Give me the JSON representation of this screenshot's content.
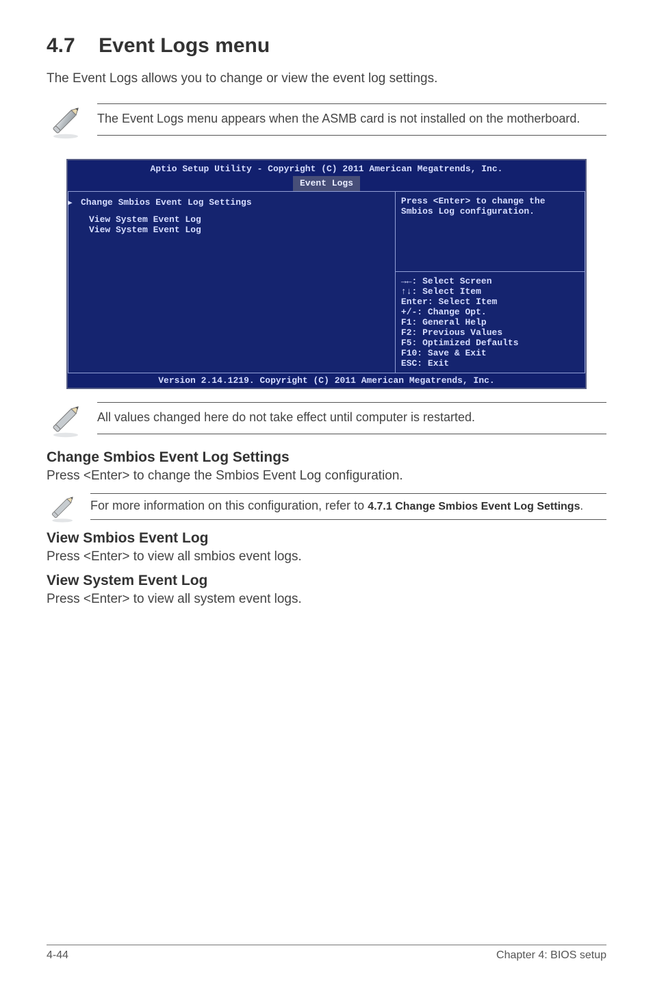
{
  "heading": {
    "number": "4.7",
    "title": "Event Logs menu"
  },
  "intro": "The Event Logs allows you to change or view the event log settings.",
  "notes": {
    "top": "The Event Logs menu appears when the ASMB card is not installed on the motherboard.",
    "after_bios": "All values changed here do not take effect until computer is restarted.",
    "config_ref_pre": "For more information on this configuration, refer to ",
    "config_ref_bold": "4.7.1 Change Smbios Event Log Settings",
    "config_ref_post": "."
  },
  "bios": {
    "title": "Aptio Setup Utility - Copyright (C) 2011 American Megatrends, Inc.",
    "tab": "Event Logs",
    "menu_items": [
      "Change Smbios Event Log Settings",
      "View System Event Log",
      "View System Event Log"
    ],
    "help": "Press <Enter> to change the Smbios Log configuration.",
    "keys": [
      "→←: Select Screen",
      "↑↓:  Select Item",
      "Enter: Select Item",
      "+/-: Change Opt.",
      "F1: General Help",
      "F2: Previous Values",
      "F5: Optimized Defaults",
      "F10: Save & Exit",
      "ESC: Exit"
    ],
    "footer": "Version 2.14.1219. Copyright (C) 2011 American Megatrends, Inc."
  },
  "sections": [
    {
      "title": "Change Smbios Event Log Settings",
      "body": "Press <Enter> to change the Smbios Event Log configuration."
    },
    {
      "title": "View Smbios Event Log",
      "body": "Press <Enter> to view all smbios event logs."
    },
    {
      "title": "View System Event Log",
      "body": "Press <Enter> to view all system event logs."
    }
  ],
  "footer": {
    "left": "4-44",
    "right": "Chapter 4: BIOS setup"
  }
}
